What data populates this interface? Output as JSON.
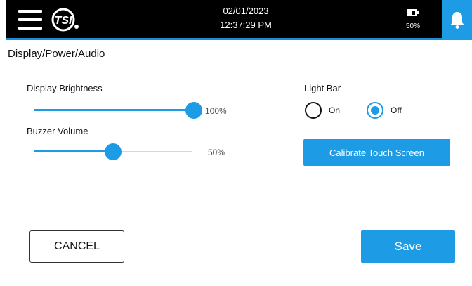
{
  "header": {
    "date": "02/01/2023",
    "time": "12:37:29 PM",
    "battery_percent": "50%",
    "logo_text": "TSI"
  },
  "page": {
    "title": "Display/Power/Audio"
  },
  "display_brightness": {
    "label": "Display Brightness",
    "value_text": "100%",
    "level": 1.0
  },
  "buzzer_volume": {
    "label": "Buzzer Volume",
    "value_text": "50%",
    "level": 0.5
  },
  "light_bar": {
    "label": "Light Bar",
    "options": [
      {
        "label": "On",
        "selected": false
      },
      {
        "label": "Off",
        "selected": true
      }
    ]
  },
  "actions": {
    "calibrate_label": "Calibrate Touch Screen",
    "cancel_label": "CANCEL",
    "save_label": "Save"
  },
  "colors": {
    "accent": "#1d9be5",
    "topbar": "#000000"
  },
  "icons": [
    "menu-icon",
    "tsi-logo",
    "battery-icon",
    "bell-icon"
  ]
}
